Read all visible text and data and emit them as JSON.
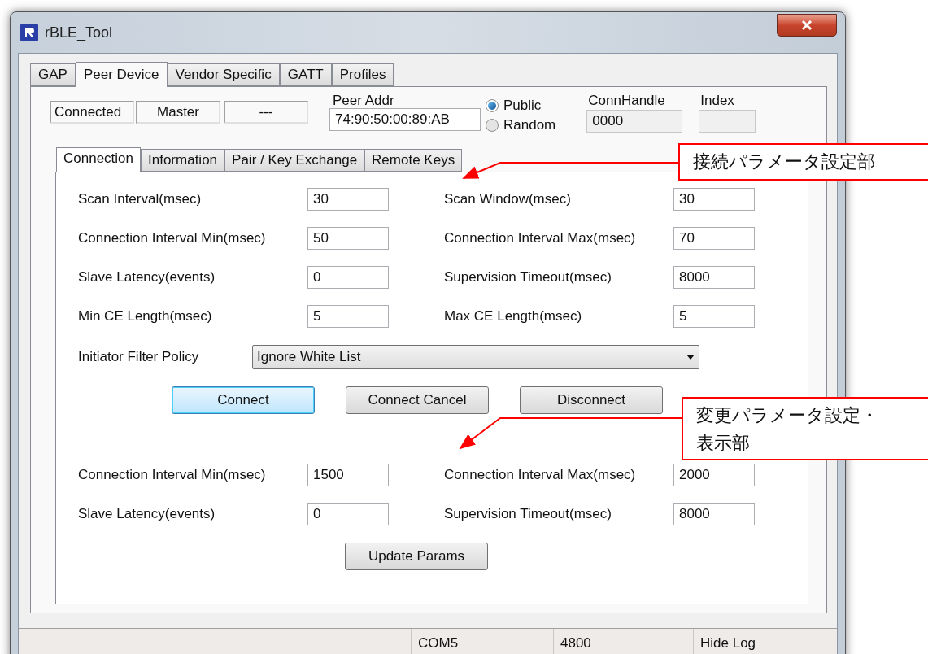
{
  "window": {
    "title": "rBLE_Tool"
  },
  "main_tabs": [
    {
      "label": "GAP",
      "selected": false
    },
    {
      "label": "Peer Device",
      "selected": true
    },
    {
      "label": "Vendor Specific",
      "selected": false
    },
    {
      "label": "GATT",
      "selected": false
    },
    {
      "label": "Profiles",
      "selected": false
    }
  ],
  "status_fields": [
    "Connected",
    "Master",
    "---"
  ],
  "peer_addr": {
    "label": "Peer Addr",
    "value": "74:90:50:00:89:AB"
  },
  "address_type": [
    {
      "label": "Public",
      "selected": true
    },
    {
      "label": "Random",
      "selected": false
    }
  ],
  "conn_handle": {
    "label": "ConnHandle",
    "value": "0000"
  },
  "index": {
    "label": "Index"
  },
  "sub_tabs": [
    {
      "label": "Connection",
      "selected": true
    },
    {
      "label": "Information",
      "selected": false
    },
    {
      "label": "Pair / Key Exchange",
      "selected": false
    },
    {
      "label": "Remote Keys",
      "selected": false
    }
  ],
  "connection_params": [
    [
      {
        "label": "Scan Interval(msec)",
        "value": "30"
      },
      {
        "label": "Scan Window(msec)",
        "value": "30"
      }
    ],
    [
      {
        "label": "Connection Interval Min(msec)",
        "value": "50"
      },
      {
        "label": "Connection Interval Max(msec)",
        "value": "70"
      }
    ],
    [
      {
        "label": "Slave Latency(events)",
        "value": "0"
      },
      {
        "label": "Supervision Timeout(msec)",
        "value": "8000"
      }
    ],
    [
      {
        "label": "Min CE Length(msec)",
        "value": "5"
      },
      {
        "label": "Max CE Length(msec)",
        "value": "5"
      }
    ]
  ],
  "filter_policy": {
    "label": "Initiator Filter Policy",
    "value": "Ignore White List"
  },
  "connect_buttons": [
    {
      "label": "Connect",
      "focused": true
    },
    {
      "label": "Connect Cancel",
      "focused": false
    },
    {
      "label": "Disconnect",
      "focused": false
    }
  ],
  "update_params": [
    [
      {
        "label": "Connection Interval Min(msec)",
        "value": "1500"
      },
      {
        "label": "Connection Interval Max(msec)",
        "value": "2000"
      }
    ],
    [
      {
        "label": "Slave Latency(events)",
        "value": "0"
      },
      {
        "label": "Supervision Timeout(msec)",
        "value": "8000"
      }
    ]
  ],
  "update_button": {
    "label": "Update Params"
  },
  "status_bar": [
    "COM5",
    "4800",
    "Hide Log"
  ],
  "annotations": [
    {
      "lines": [
        "接続パラメータ設定部"
      ]
    },
    {
      "lines": [
        "変更パラメータ設定・",
        "表示部"
      ]
    }
  ]
}
